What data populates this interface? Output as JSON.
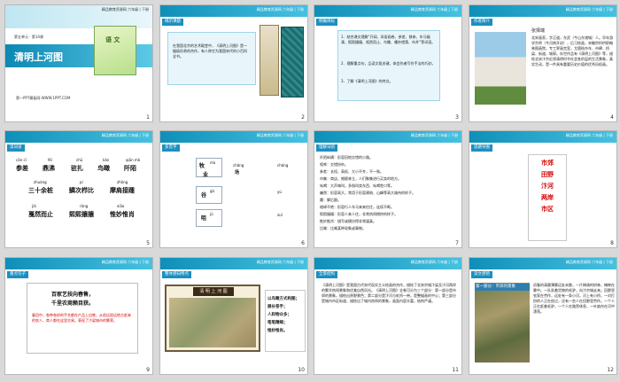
{
  "header_text": "精品教育资源网 六年级 | 下册",
  "slides": [
    {
      "num": "1",
      "subtitle": "第五单元 · 第14课",
      "title": "清明上河图",
      "book": "语 文",
      "site": "第一PPT模板网-WWW.1PPT.COM"
    },
    {
      "num": "2",
      "tag": "揭示课题",
      "text": "在我国北京的艺术殿堂中，《清明上河图》是一幅极珍贵的杰作，有人称它为我国宋代的小百科全书。"
    },
    {
      "num": "3",
      "tag": "明确目标",
      "items": [
        "1．结合课文理解“开阔、风俗画卷、参差、移来、车马辐凑、熙熙攘攘、喧然而止、鸟瞰、嘈杂错落、市井”等词语。",
        "2．理解重点句，品读文段关键，体会作者写作手法的巧妙。",
        "3．了解《清明上河图》的特点。"
      ]
    },
    {
      "num": "4",
      "tag": "作者简介",
      "name": "张择端",
      "text": "北宋画家，字正道，东武（今山东诸城）人。早年游学京师（今河南开封），后习绘画，宋徽宗时供职翰林图画院，专工界画宫室，尤擅绘舟车、市肆、桥梁、街道、城郭。存世作品有《清明上河图》等，描绘北宋汴京近郊清明时节社会各阶层的生活景象，真实生动，是一件具有重要历史价值的优秀风俗画。"
    },
    {
      "num": "5",
      "tag": "读词语",
      "row1_py": [
        "cān  cī",
        "fēi",
        "chū",
        "kǎn",
        "qiān mò"
      ],
      "row1": [
        "参差",
        "鼎沸",
        "驻扎",
        "鸟瞰",
        "阡陌"
      ],
      "row2_py": [
        "zhuàng",
        "pí",
        "zhōng"
      ],
      "row2": [
        "三十余桩",
        "鳞次栉比",
        "摩肩接踵"
      ],
      "row3_py": [
        "jiǎ",
        "rǎng",
        "xiāo"
      ],
      "row3": [
        "戛然而止",
        "熙熙攘攘",
        "惟妙惟肖"
      ]
    },
    {
      "num": "6",
      "tag": "多音字",
      "chars": [
        [
          "牧",
          "mù"
        ],
        [
          "业",
          "yè"
        ],
        [
          "场",
          "chǎng"
        ],
        [
          "cháng"
        ],
        [
          "谷",
          "gǔ"
        ],
        [
          "yù"
        ],
        [
          "咀",
          "jǔ"
        ],
        [
          "zuǐ"
        ]
      ]
    },
    {
      "num": "7",
      "tag": "理解词语",
      "lines": [
        "阡陌纵横：形容田地交错的小路。",
        "喧哗：交错纷杂。",
        "参差：长短、高低、大小不齐，不一致。",
        "市集：商店、摊贩林立，人们聚集进行买卖的地方。",
        "吆喝：大声喊叫，多指叫卖东西、吆喝牲口等。",
        "巍然：形容高大，常用于形容建筑、山峰等高大雄伟的样子。",
        "踵：脚后跟。",
        "络绎不绝：形容行人车马来来往往，连续不断。",
        "熙熙攘攘：形容人来人往，非常热闹拥挤的样子。",
        "惟妙惟肖：描写或模仿得非常逼真。",
        "比喻：比喻某种现象或事物。"
      ]
    },
    {
      "num": "8",
      "tag": "思路导图",
      "items": [
        "市郊",
        "田野",
        "汴河",
        "两岸",
        "市区"
      ]
    },
    {
      "num": "9",
      "tag": "重点句子",
      "title1": "百家艺技向春售，",
      "title2": "千里农商赖目获。",
      "text": "春回中，各种各样的手艺都在产品上出售，从很远很远地方赶来的农人、商人都在这里交易。表现了汴梁城市的繁荣。"
    },
    {
      "num": "10",
      "tag": "整体感知特点",
      "scroll_title": "清 明 上 河 图",
      "notes": [
        "以鸟瞰方式构图；",
        "展长卷手；",
        "人和物众多；",
        "笔笔精细；",
        "惟妙惟肖。"
      ]
    },
    {
      "num": "11",
      "tag": "全景结构",
      "text": "《清明上河图》是我国古代宋代现实主义绘画的杰作，描绘了北宋京城汴梁及汴河两岸的繁华热闹景象和优美自然风光。《清明上河图》全卷可分为三个部分：第一部分是市郊的景象，描绘出原野景色；第二部分是汴河与虹桥一带，是整幅画的中心；第三部分是城内市区街道，描绘出了城内热闹的景象，画面内容丰富，结构严谨。"
    },
    {
      "num": "12",
      "tag": "读文感悟",
      "heading": "第一部分：市郊的景象",
      "text": "初春的清晨薄雾远处未散，一片稀疏的树林，掩映在雾中。一队驮着货物的毛驴，向汴京城走来。田野里农家在劳作，远处有一条小河，河上有小桥，一对打扮的人正在经过，还有一些人在田野里劳作。一个人正在赶着毛驴，一个人在路旁休息，一叶扁舟在河中漂荡。"
    }
  ]
}
